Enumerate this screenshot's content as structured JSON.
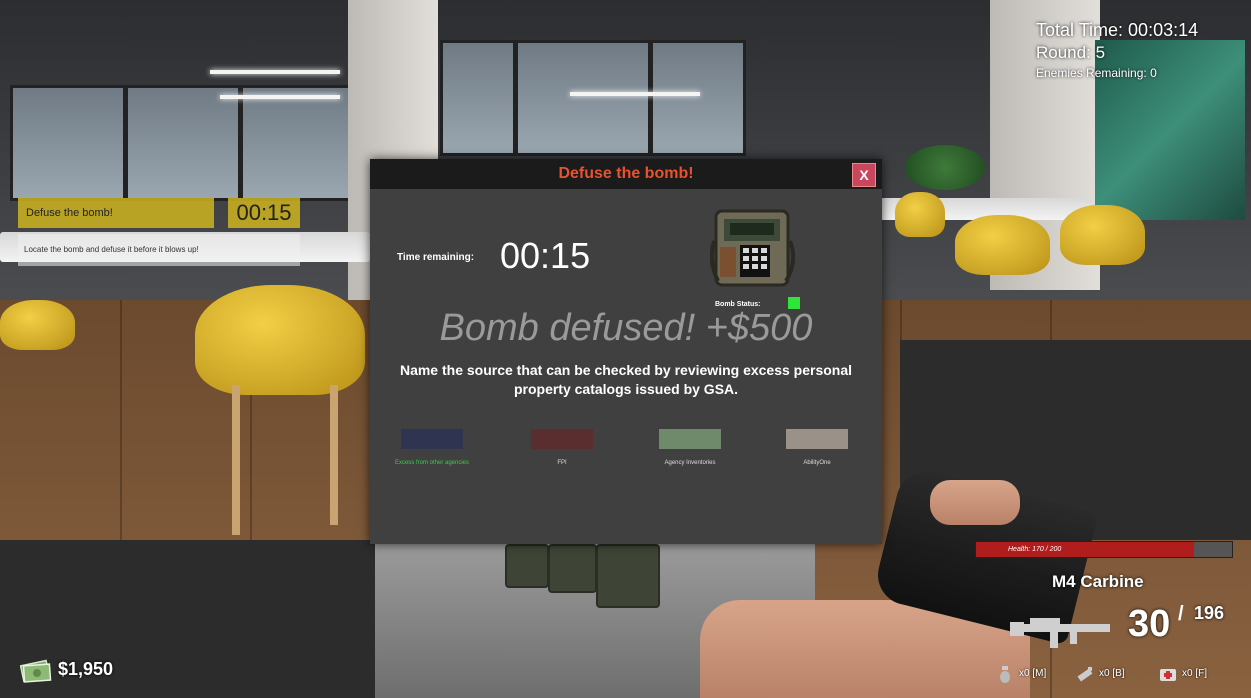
{
  "hud": {
    "total_time_label": "Total Time:",
    "total_time": "00:03:14",
    "round_label": "Round:",
    "round": "5",
    "enemies_label": "Enemies Remaining:",
    "enemies": "0"
  },
  "objective": {
    "title": "Defuse the bomb!",
    "timer": "00:15",
    "description": "Locate the bomb and defuse it before it blows up!"
  },
  "modal": {
    "title": "Defuse the bomb!",
    "close_label": "X",
    "time_label": "Time remaining:",
    "time_value": "00:15",
    "bomb_status_label": "Bomb Status:",
    "bomb_status_color": "#2ee63a",
    "result_message": "Bomb defused! +$500",
    "question": "Name the source that can be checked by reviewing excess personal property catalogs issued by GSA.",
    "answers": [
      {
        "label": "Excess from other agencies",
        "color": "#2f3550",
        "label_color": "#3ec94a"
      },
      {
        "label": "FPI",
        "color": "#5a2e2e",
        "label_color": "#dddddd"
      },
      {
        "label": "Agency Inventories",
        "color": "#6f8a6a",
        "label_color": "#dddddd"
      },
      {
        "label": "AbilityOne",
        "color": "#9a9288",
        "label_color": "#dddddd"
      }
    ]
  },
  "status": {
    "health_text": "Health: 170 / 200",
    "health_fraction": 0.85,
    "weapon_name": "M4 Carbine",
    "ammo_mag": "30",
    "ammo_separator": "/",
    "ammo_reserve": "196",
    "money": "$1,950"
  },
  "inventory": [
    {
      "icon": "grenade-icon",
      "text": "x0 [M]"
    },
    {
      "icon": "flashbang-icon",
      "text": "x0 [B]"
    },
    {
      "icon": "medkit-icon",
      "text": "x0 [F]"
    }
  ]
}
